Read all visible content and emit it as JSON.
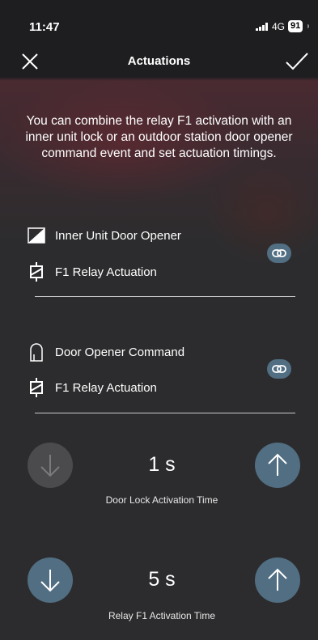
{
  "status_bar": {
    "time": "11:47",
    "network": "4G",
    "battery": "91"
  },
  "header": {
    "title": "Actuations"
  },
  "intro_text": "You can combine the relay F1 activation with an inner unit lock or an outdoor station door opener command event and set actuation timings.",
  "groups": [
    {
      "event_label": "Inner Unit Door Opener",
      "event_icon": "inner-unit-door-icon",
      "action_label": "F1 Relay Actuation",
      "action_icon": "relay-icon",
      "link_icon": "link-icon"
    },
    {
      "event_label": "Door Opener Command",
      "event_icon": "outdoor-door-icon",
      "action_label": "F1 Relay Actuation",
      "action_icon": "relay-icon",
      "link_icon": "link-icon"
    }
  ],
  "timers": [
    {
      "value": "1 s",
      "label": "Door Lock Activation Time",
      "decrease_enabled": false,
      "increase_enabled": true
    },
    {
      "value": "5 s",
      "label": "Relay F1 Activation Time",
      "decrease_enabled": true,
      "increase_enabled": true
    }
  ],
  "colors": {
    "accent": "#516e82",
    "disabled": "#4b4b4d",
    "background": "#2c2c2e",
    "header_tint": "#4a2a31"
  }
}
